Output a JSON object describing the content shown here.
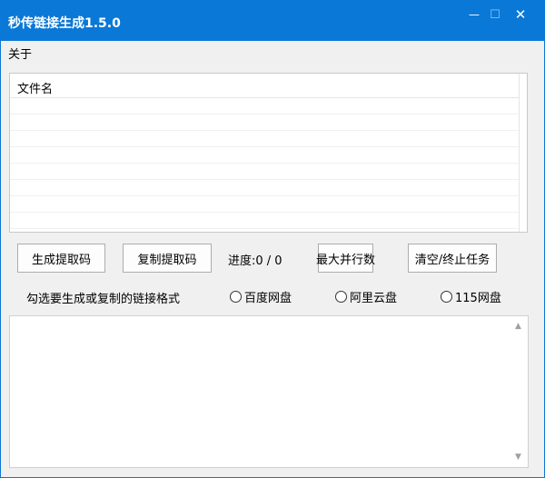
{
  "window": {
    "title": "秒传链接生成1.5.0",
    "controls": {
      "minimize": "—",
      "maximize": "☐",
      "close": "✕"
    }
  },
  "menu": {
    "items": [
      {
        "label": "关于"
      }
    ]
  },
  "file_list": {
    "columns": [
      {
        "label": "文件名"
      }
    ],
    "rows": []
  },
  "toolbar": {
    "generate_label": "生成提取码",
    "copy_label": "复制提取码",
    "progress_label": "进度:0 / 0",
    "max_parallel_label": "最大并行数",
    "clear_stop_label": "清空/终止任务"
  },
  "format": {
    "prompt": "勾选要生成或复制的链接格式",
    "options": [
      {
        "label": "百度网盘",
        "checked": false
      },
      {
        "label": "阿里云盘",
        "checked": false
      },
      {
        "label": "115网盘",
        "checked": false
      }
    ]
  },
  "output": {
    "value": ""
  },
  "colors": {
    "titlebar": "#0a78d7",
    "window_bg": "#f0f0f0"
  }
}
